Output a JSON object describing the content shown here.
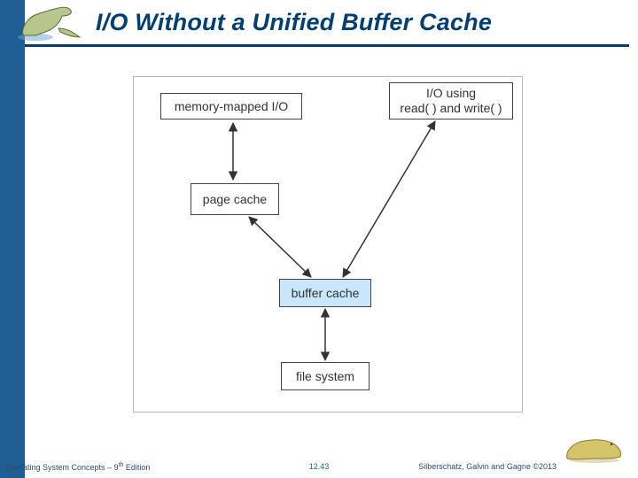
{
  "title": "I/O Without a Unified Buffer Cache",
  "boxes": {
    "memory_mapped": "memory-mapped I/O",
    "read_write": "I/O using\nread( ) and write( )",
    "page_cache": "page cache",
    "buffer_cache": "buffer cache",
    "file_system": "file system"
  },
  "footer": {
    "left_prefix": "Operating System Concepts – 9",
    "left_suffix": " Edition",
    "left_ord": "th",
    "center": "12.43",
    "right": "Silberschatz, Galvin and Gagne ©2013"
  },
  "icons": {
    "top_left": "dinosaur-blue-icon",
    "bottom_right": "dinosaur-yellow-icon"
  },
  "chart_data": {
    "type": "diagram",
    "title": "I/O Without a Unified Buffer Cache",
    "nodes": [
      {
        "id": "memory_mapped",
        "label": "memory-mapped I/O"
      },
      {
        "id": "read_write",
        "label": "I/O using read( ) and write( )"
      },
      {
        "id": "page_cache",
        "label": "page cache"
      },
      {
        "id": "buffer_cache",
        "label": "buffer cache",
        "highlight": true
      },
      {
        "id": "file_system",
        "label": "file system"
      }
    ],
    "edges": [
      {
        "from": "memory_mapped",
        "to": "page_cache",
        "bidirectional": true
      },
      {
        "from": "page_cache",
        "to": "buffer_cache",
        "bidirectional": true
      },
      {
        "from": "read_write",
        "to": "buffer_cache",
        "bidirectional": true
      },
      {
        "from": "buffer_cache",
        "to": "file_system",
        "bidirectional": true
      }
    ]
  }
}
